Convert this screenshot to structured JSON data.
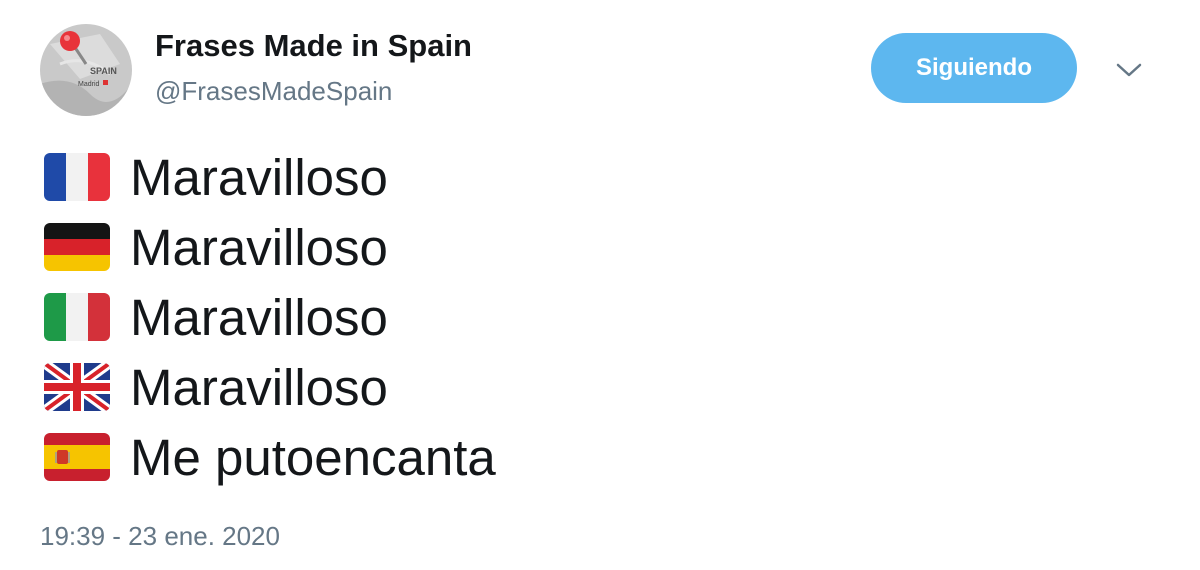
{
  "tweet": {
    "author": {
      "name": "Frases Made in Spain",
      "handle": "@FrasesMadeSpain",
      "avatar_icon": "map-pin-spain-icon"
    },
    "follow_button": {
      "label": "Siguiendo",
      "color": "#5db7ef"
    },
    "menu_icon": "chevron-down-icon",
    "lines": [
      {
        "flag": "france-flag-icon",
        "text": "Maravilloso"
      },
      {
        "flag": "germany-flag-icon",
        "text": "Maravilloso"
      },
      {
        "flag": "italy-flag-icon",
        "text": "Maravilloso"
      },
      {
        "flag": "uk-flag-icon",
        "text": "Maravilloso"
      },
      {
        "flag": "spain-flag-icon",
        "text": "Me putoencanta"
      }
    ],
    "timestamp": "19:39 - 23 ene. 2020"
  },
  "colors": {
    "text": "#14171a",
    "secondary_text": "#657786",
    "accent": "#5db7ef"
  }
}
